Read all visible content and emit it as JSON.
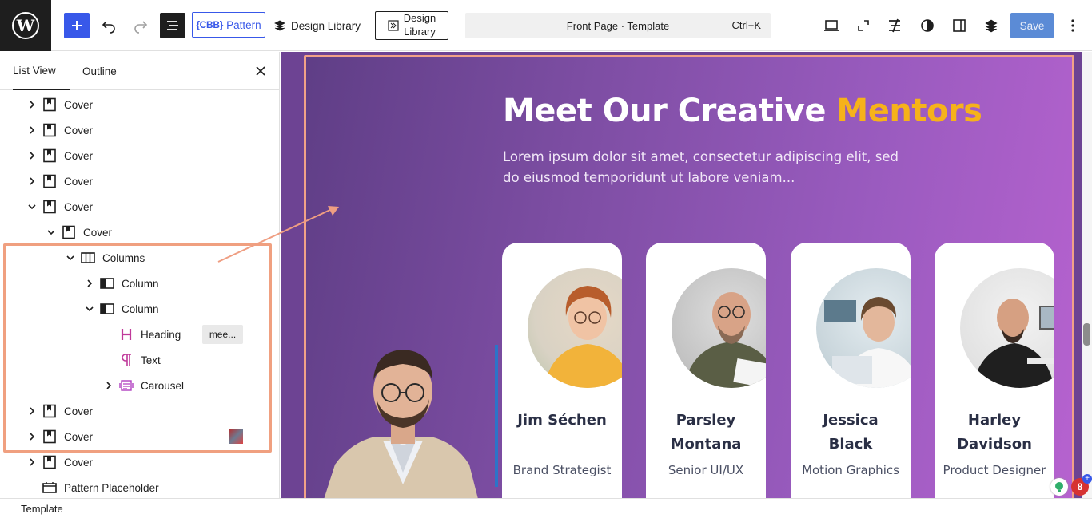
{
  "toolbar": {
    "pattern_tag": "{CBB}",
    "pattern_label": "Pattern",
    "design_library_label": "Design Library",
    "design_library_box_line1": "Design",
    "design_library_box_line2": "Library",
    "document_title": "Front Page · Template",
    "shortcut": "Ctrl+K",
    "save_label": "Save",
    "icons": [
      "wordpress-logo",
      "plus",
      "undo",
      "redo",
      "list-view",
      "laptop-preview",
      "fullscreen",
      "spectra",
      "styles-contrast",
      "settings-sidebar",
      "stackable",
      "more-options"
    ]
  },
  "sidebar": {
    "tabs": [
      {
        "label": "List View",
        "active": true
      },
      {
        "label": "Outline",
        "active": false
      }
    ],
    "rows": [
      {
        "label": "Cover",
        "icon": "cover-icon",
        "depth": 0,
        "expanded": false
      },
      {
        "label": "Cover",
        "icon": "cover-icon",
        "depth": 0,
        "expanded": false
      },
      {
        "label": "Cover",
        "icon": "cover-icon",
        "depth": 0,
        "expanded": false
      },
      {
        "label": "Cover",
        "icon": "cover-icon",
        "depth": 0,
        "expanded": false
      },
      {
        "label": "Cover",
        "icon": "cover-icon",
        "depth": 0,
        "expanded": true
      },
      {
        "label": "Cover",
        "icon": "cover-icon",
        "depth": 1,
        "expanded": true
      },
      {
        "label": "Columns",
        "icon": "columns-icon",
        "depth": 2,
        "expanded": true
      },
      {
        "label": "Column",
        "icon": "column-icon",
        "depth": 3,
        "expanded": false
      },
      {
        "label": "Column",
        "icon": "column-icon",
        "depth": 3,
        "expanded": true
      },
      {
        "label": "Heading",
        "icon": "heading-icon",
        "depth": 4,
        "badge": "mee..."
      },
      {
        "label": "Text",
        "icon": "paragraph-icon",
        "depth": 4
      },
      {
        "label": "Carousel",
        "icon": "carousel-icon",
        "depth": 4,
        "expanded": false
      },
      {
        "label": "Cover",
        "icon": "cover-icon",
        "depth": 0,
        "expanded": false
      },
      {
        "label": "Cover",
        "icon": "cover-icon",
        "depth": 0,
        "expanded": false,
        "thumbnail": true
      },
      {
        "label": "Cover",
        "icon": "cover-icon",
        "depth": 0,
        "expanded": false
      },
      {
        "label": "Pattern Placeholder",
        "icon": "pattern-placeholder-icon",
        "depth": 0
      }
    ]
  },
  "footer": {
    "breadcrumb": "Template"
  },
  "canvas": {
    "headline_main": "Meet Our Creative ",
    "headline_accent": "Mentors",
    "subtext": "Lorem ipsum dolor sit amet, consectetur adipiscing elit, sed do eiusmod temporidunt ut labore veniam...",
    "accent_color": "#f6b21a",
    "mentors": [
      {
        "name": "Jim Séchen",
        "role": "Brand Strategist"
      },
      {
        "name": "Parsley Montana",
        "role": "Senior UI/UX"
      },
      {
        "name": "Jessica Black",
        "role": "Motion Graphics"
      },
      {
        "name": "Harley Davidson",
        "role": "Product Designer"
      }
    ]
  },
  "notifications": {
    "badge_count": "8"
  }
}
